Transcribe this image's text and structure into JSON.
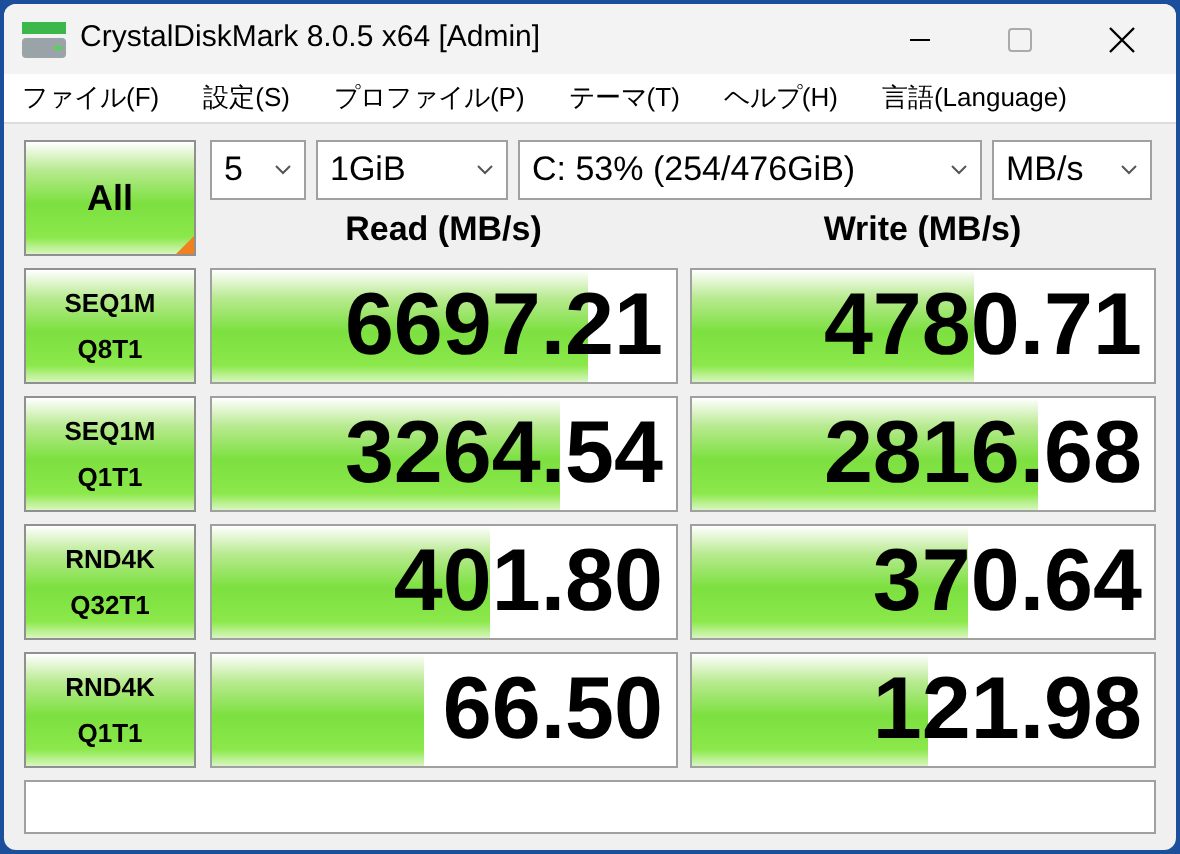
{
  "window": {
    "title": "CrystalDiskMark 8.0.5 x64 [Admin]"
  },
  "menu": [
    "ファイル(F)",
    "設定(S)",
    "プロファイル(P)",
    "テーマ(T)",
    "ヘルプ(H)",
    "言語(Language)"
  ],
  "all_button": "All",
  "dropdowns": [
    "5",
    "1GiB",
    "C: 53% (254/476GiB)",
    "MB/s"
  ],
  "headers": [
    "Read (MB/s)",
    "Write (MB/s)"
  ],
  "tests": [
    {
      "line1": "SEQ1M",
      "line2": "Q8T1",
      "read": {
        "value": "6697.21",
        "level": 0.81
      },
      "write": {
        "value": "4780.71",
        "level": 0.61
      }
    },
    {
      "line1": "SEQ1M",
      "line2": "Q1T1",
      "read": {
        "value": "3264.54",
        "level": 0.75
      },
      "write": {
        "value": "2816.68",
        "level": 0.75
      }
    },
    {
      "line1": "RND4K",
      "line2": "Q32T1",
      "read": {
        "value": "401.80",
        "level": 0.6
      },
      "write": {
        "value": "370.64",
        "level": 0.6
      }
    },
    {
      "line1": "RND4K",
      "line2": "Q1T1",
      "read": {
        "value": "66.50",
        "level": 0.46
      },
      "write": {
        "value": "121.98",
        "level": 0.51
      }
    }
  ]
}
